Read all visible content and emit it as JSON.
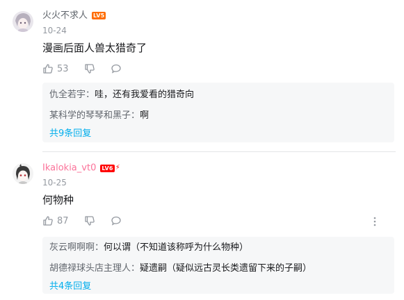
{
  "comments": [
    {
      "username": "火火不求人",
      "level": "LV5",
      "time": "10-24",
      "content": "漫画后面人兽太猎奇了",
      "likes": "53",
      "replies": [
        {
          "name": "仇全若宇",
          "sep": "：",
          "text": "哇，还有我爱看的猎奇向"
        },
        {
          "name": "某科学的琴琴和黑子",
          "sep": "：",
          "text": "啊"
        }
      ],
      "view_more": "共9条回复"
    },
    {
      "username": "Ikalokia_vt0",
      "level": "LV6",
      "time": "10-25",
      "content": "何物种",
      "likes": "87",
      "replies": [
        {
          "name": "灰云啊啊啊",
          "sep": "：",
          "text": "何以谓（不知道该称呼为什么物种）"
        },
        {
          "name": "胡德禄球头店主理人",
          "sep": "：",
          "text": "疑遗嗣（疑似远古灵长类遗留下来的子嗣）"
        }
      ],
      "view_more": "共4条回复"
    }
  ],
  "colors": {
    "username_pink": "#fb7299",
    "level5": "#ff6c00",
    "level6": "#ff0000",
    "link_blue": "#00aeec",
    "reply_bg": "#f6f7f8"
  },
  "icons": [
    "thumbs-up-icon",
    "thumbs-down-icon",
    "reply-bubble-icon",
    "more-icon"
  ]
}
